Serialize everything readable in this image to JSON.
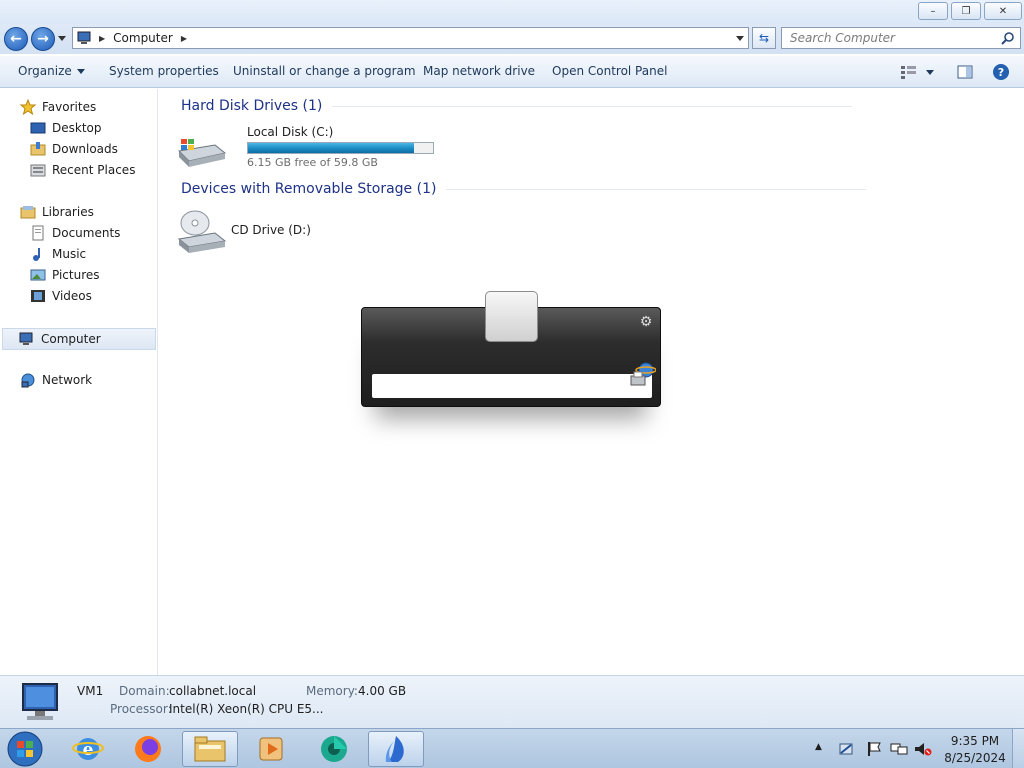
{
  "window": {
    "minimize_label": "–",
    "maximize_label": "❐",
    "close_label": "✕"
  },
  "address": {
    "location": "Computer",
    "search_placeholder": "Search Computer"
  },
  "toolbar": {
    "organize": "Organize",
    "system_properties": "System properties",
    "uninstall": "Uninstall or change a program",
    "map_drive": "Map network drive",
    "control_panel": "Open Control Panel"
  },
  "sidebar": {
    "favorites": "Favorites",
    "desktop": "Desktop",
    "downloads": "Downloads",
    "recent": "Recent Places",
    "libraries": "Libraries",
    "documents": "Documents",
    "music": "Music",
    "pictures": "Pictures",
    "videos": "Videos",
    "computer": "Computer",
    "network": "Network"
  },
  "main": {
    "hdd_group": "Hard Disk Drives (1)",
    "local_disk": "Local Disk (C:)",
    "local_disk_free": "6.15 GB free of 59.8 GB",
    "local_disk_used_fraction": 0.897,
    "removable_group": "Devices with Removable Storage (1)",
    "cd_drive": "CD Drive (D:)"
  },
  "details": {
    "name": "VM1",
    "domain_label": "Domain:",
    "domain_value": "collabnet.local",
    "memory_label": "Memory:",
    "memory_value": "4.00 GB",
    "processor_label": "Processor:",
    "processor_value": "Intel(R) Xeon(R) CPU E5..."
  },
  "taskbar": {
    "time": "9:35 PM",
    "date": "8/25/2024"
  },
  "colors": {
    "accent_blue": "#1d5bb8",
    "group_header": "#1e3287",
    "capacity_fill": "#1d8ac2"
  }
}
